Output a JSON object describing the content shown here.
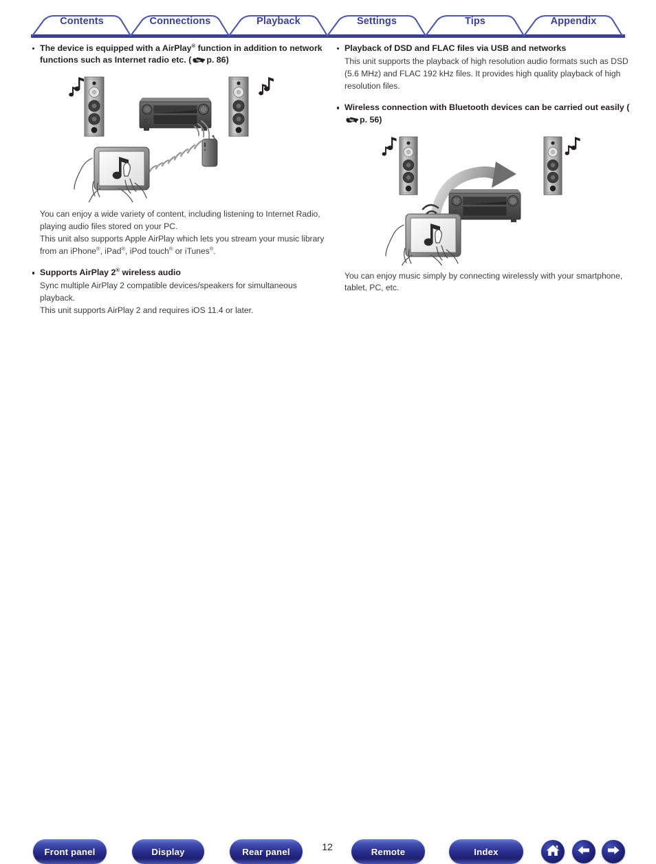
{
  "document": {
    "page_number": "12"
  },
  "tabs": [
    {
      "label": "Contents",
      "name": "tab-contents"
    },
    {
      "label": "Connections",
      "name": "tab-connections"
    },
    {
      "label": "Playback",
      "name": "tab-playback"
    },
    {
      "label": "Settings",
      "name": "tab-settings"
    },
    {
      "label": "Tips",
      "name": "tab-tips"
    },
    {
      "label": "Appendix",
      "name": "tab-appendix"
    }
  ],
  "left_column": {
    "bullet1": {
      "heading_part1": "The device is equipped with a AirPlay",
      "heading_sup1": "®",
      "heading_part2": " function in addition to network functions such as Internet radio etc.  (",
      "heading_ref": "p. 86",
      "heading_part3": ")"
    },
    "caption1_line1": "You can enjoy a wide variety of content, including listening to Internet Radio, playing audio files stored on your PC.",
    "caption1_line2_a": "This unit also supports Apple AirPlay which lets you stream your music library from an iPhone",
    "caption1_sup_a": "®",
    "caption1_line2_b": ", iPad",
    "caption1_sup_b": "®",
    "caption1_line2_c": ", iPod touch",
    "caption1_sup_c": "®",
    "caption1_line2_d": " or iTunes",
    "caption1_sup_d": "®",
    "caption1_line2_e": ".",
    "bullet2": {
      "heading_part1": "Supports AirPlay 2",
      "heading_sup1": "®",
      "heading_part2": " wireless audio"
    },
    "caption2_line1": "Sync multiple AirPlay 2 compatible devices/speakers for simultaneous playback.",
    "caption2_line2": "This unit supports AirPlay 2 and requires iOS 11.4 or later."
  },
  "right_column": {
    "bullet1": {
      "heading": "Playback of DSD and FLAC files via USB and networks"
    },
    "caption1": "This unit supports the playback of high resolution audio formats such as DSD (5.6 MHz) and FLAC 192 kHz files. It provides high quality playback of high resolution files.",
    "bullet2": {
      "heading_part1": "Wireless connection with Bluetooth devices can be carried out easily  (",
      "heading_ref": "p. 56",
      "heading_part2": ")"
    },
    "caption2": "You can enjoy music simply by connecting wirelessly with your smartphone, tablet, PC, etc."
  },
  "bottom_nav": {
    "buttons": [
      {
        "label": "Front panel",
        "name": "front-panel-button"
      },
      {
        "label": "Display",
        "name": "display-button"
      },
      {
        "label": "Rear panel",
        "name": "rear-panel-button"
      },
      {
        "label": "Remote",
        "name": "remote-button"
      },
      {
        "label": "Index",
        "name": "index-button"
      }
    ],
    "icons": [
      {
        "name": "home-icon"
      },
      {
        "name": "arrow-left-icon"
      },
      {
        "name": "arrow-right-icon"
      }
    ]
  },
  "colors": {
    "tab_blue": "#3b4095",
    "tab_stroke": "#4c56a8",
    "button_blue": "#2b2f8f",
    "text_dark": "#231f20"
  }
}
